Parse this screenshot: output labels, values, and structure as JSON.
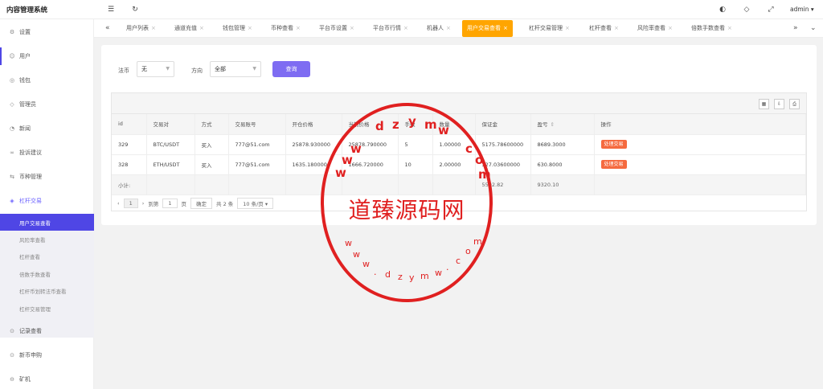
{
  "app": {
    "title": "内容管理系统",
    "user": "admin"
  },
  "header_icons": [
    "menu-fold-icon",
    "refresh-icon",
    "theme-icon",
    "tag-icon",
    "fullscreen-icon"
  ],
  "sidebar": {
    "items": [
      {
        "label": "设置",
        "icon": "gear-icon"
      },
      {
        "label": "用户",
        "icon": "user-icon"
      },
      {
        "label": "钱包",
        "icon": "wallet-icon"
      },
      {
        "label": "管理员",
        "icon": "shield-icon"
      },
      {
        "label": "新闻",
        "icon": "news-icon"
      },
      {
        "label": "投诉建议",
        "icon": "link-icon"
      },
      {
        "label": "币种管理",
        "icon": "coin-icon"
      },
      {
        "label": "杠杆交易",
        "icon": "leverage-icon"
      }
    ],
    "sub_items": [
      "用户交易查看",
      "风险率查看",
      "杠杆查看",
      "倍数手数查看",
      "杠杆币划转法币查看",
      "杠杆交易管理"
    ],
    "bottom_items": [
      {
        "label": "记录查看",
        "icon": "record-icon"
      },
      {
        "label": "新币申购",
        "icon": "subscribe-icon"
      },
      {
        "label": "矿机",
        "icon": "miner-icon"
      }
    ]
  },
  "tabs": [
    "用户列表",
    "通道充值",
    "钱包管理",
    "币种查看",
    "平台币设置",
    "平台币行情",
    "机器人",
    "用户交易查看",
    "杠杆交易管理",
    "杠杆查看",
    "风险率查看",
    "倍数手数查看"
  ],
  "filters": {
    "fiat_label": "法币",
    "fiat_value": "无",
    "direction_label": "方向",
    "direction_value": "全部",
    "query_button": "查询"
  },
  "table": {
    "headers": [
      "id",
      "交易对",
      "方式",
      "交易账号",
      "开仓价格",
      "当前价格",
      "手数",
      "数量",
      "保证金",
      "盈亏",
      "操作"
    ],
    "rows": [
      [
        "329",
        "BTC/USDT",
        "买入",
        "777@51.com",
        "25878.930000",
        "25878.790000",
        "5",
        "1.00000",
        "5175.78600000",
        "8689.3000",
        "处理交易"
      ],
      [
        "328",
        "ETH/USDT",
        "买入",
        "777@51.com",
        "1635.180000",
        "1666.720000",
        "10",
        "2.00000",
        "327.03600000",
        "630.8000",
        "处理交易"
      ]
    ],
    "total_label": "小计:",
    "total_margin": "5502.82",
    "total_pnl": "9320.10"
  },
  "pagination": {
    "prev": "‹",
    "next": "›",
    "current": "1",
    "goto_label": "到第",
    "page_input": "1",
    "page_unit": "页",
    "confirm": "确定",
    "total": "共 2 条",
    "page_size": "10 条/页"
  },
  "stamp": {
    "text": "道臻源码网",
    "colors": {
      "stamp": "#e02020",
      "accent": "#4f46e5",
      "tab_active": "#ffa500",
      "badge": "#f56a3f"
    }
  }
}
